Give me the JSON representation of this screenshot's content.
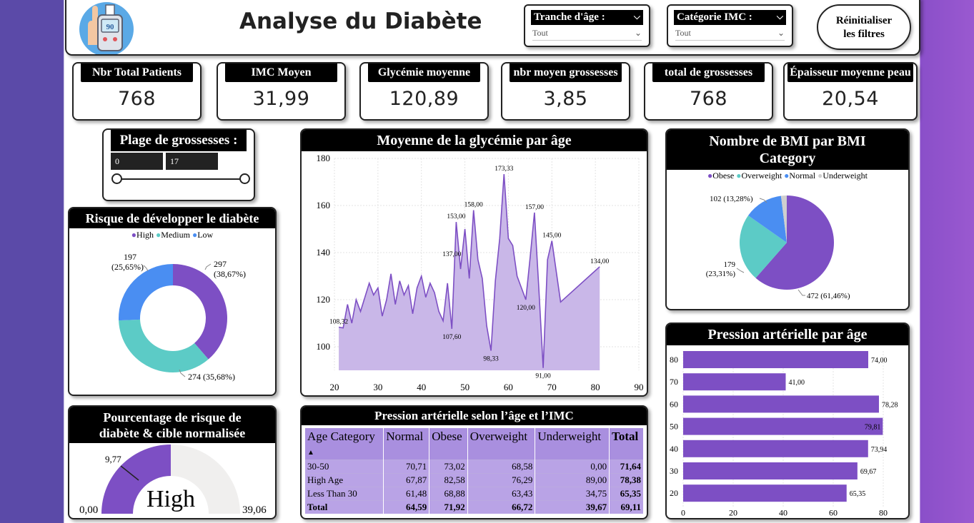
{
  "header": {
    "title": "Analyse du Diabète",
    "logo_number": "90",
    "age_slicer": {
      "label": "Tranche d'âge :",
      "value": "Tout"
    },
    "bmi_slicer": {
      "label": "Catégorie IMC :",
      "value": "Tout"
    },
    "reset_line1": "Réinitialiser",
    "reset_line2": "les filtres"
  },
  "kpis": [
    {
      "label": "Nbr Total Patients",
      "value": "768"
    },
    {
      "label": "IMC Moyen",
      "value": "31,99"
    },
    {
      "label": "Glycémie moyenne",
      "value": "120,89"
    },
    {
      "label": "nbr moyen grossesses",
      "value": "3,85"
    },
    {
      "label": "total de grossesses",
      "value": "768"
    },
    {
      "label": "Épaisseur moyenne peau",
      "value": "20,54"
    }
  ],
  "pregnancy_range": {
    "title": "Plage de grossesses :",
    "min": "0",
    "max": "17"
  },
  "risk": {
    "title": "Risque de développer le diabète",
    "legend": [
      "High",
      "Medium",
      "Low"
    ],
    "labels": [
      {
        "a": "297",
        "b": "(38,67%)"
      },
      {
        "a": "274 (35,68%)",
        "b": ""
      },
      {
        "a": "197",
        "b": "(25,65%)"
      }
    ]
  },
  "gauge": {
    "title_line1": "Pourcentage de risque de",
    "title_line2": "diabète & cible normalisée",
    "min": "0,00",
    "max": "39,06",
    "target": "9,77",
    "label": "High"
  },
  "glucose_chart": {
    "title": "Moyenne de la glycémie par âge"
  },
  "bmi_pie": {
    "title_line1": "Nombre de BMI par BMI",
    "title_line2": "Category"
  },
  "bp_chart": {
    "title": "Pression artérielle par âge"
  },
  "matrix": {
    "title": "Pression artérielle selon l’âge et l’IMC",
    "headers": [
      "Age Category",
      "Normal",
      "Obese",
      "Overweight",
      "Underweight",
      "Total"
    ],
    "rows": [
      [
        "30-50",
        "70,71",
        "73,02",
        "68,58",
        "0,00",
        "71,64"
      ],
      [
        "High Age",
        "67,87",
        "82,58",
        "76,29",
        "89,00",
        "78,38"
      ],
      [
        "Less Than 30",
        "61,48",
        "68,88",
        "63,43",
        "34,75",
        "65,35"
      ],
      [
        "Total",
        "64,59",
        "71,92",
        "66,72",
        "39,67",
        "69,11"
      ]
    ]
  },
  "colors": {
    "purple": "#7d4fc4",
    "teal": "#5ccbc6",
    "blue": "#4a8ef2",
    "grey": "#cfcfcf",
    "area": "#c9b7e8"
  },
  "chart_data": [
    {
      "type": "area",
      "title": "Moyenne de la glycémie par âge",
      "xlim": [
        20,
        90
      ],
      "ylim": [
        90,
        180
      ],
      "xticks": [
        20,
        30,
        40,
        50,
        60,
        70,
        80,
        90
      ],
      "yticks": [
        100,
        120,
        140,
        160,
        180
      ],
      "x": [
        21,
        22,
        23,
        24,
        25,
        26,
        27,
        28,
        29,
        30,
        31,
        32,
        33,
        34,
        35,
        36,
        37,
        38,
        39,
        40,
        41,
        42,
        43,
        44,
        45,
        46,
        47,
        48,
        49,
        50,
        51,
        52,
        53,
        54,
        55,
        56,
        57,
        58,
        59,
        60,
        61,
        62,
        63,
        64,
        65,
        66,
        67,
        68,
        69,
        70,
        72,
        81
      ],
      "y": [
        108.32,
        108,
        118,
        110,
        120,
        115,
        121,
        127,
        122,
        125,
        113,
        120,
        131,
        118,
        128,
        122,
        126,
        114,
        125,
        130,
        121,
        127,
        123,
        115,
        111,
        127,
        107.6,
        153,
        133,
        150,
        129,
        158,
        137,
        129,
        109,
        98.33,
        128,
        146,
        173.33,
        146,
        143,
        130,
        125,
        120,
        138,
        157,
        125,
        91,
        137,
        145,
        119,
        134,
        134
      ],
      "labels": [
        {
          "x": 21,
          "y": 108.32,
          "t": "108,32"
        },
        {
          "x": 47,
          "y": 107.6,
          "t": "107,60"
        },
        {
          "x": 47,
          "y": 137,
          "t": "137,00"
        },
        {
          "x": 48,
          "y": 153,
          "t": "153,00"
        },
        {
          "x": 52,
          "y": 158,
          "t": "158,00"
        },
        {
          "x": 56,
          "y": 98.33,
          "t": "98,33"
        },
        {
          "x": 59,
          "y": 173.33,
          "t": "173,33"
        },
        {
          "x": 64,
          "y": 120,
          "t": "120,00"
        },
        {
          "x": 66,
          "y": 157,
          "t": "157,00"
        },
        {
          "x": 68,
          "y": 91,
          "t": "91,00"
        },
        {
          "x": 70,
          "y": 145,
          "t": "145,00"
        },
        {
          "x": 81,
          "y": 134,
          "t": "134,00"
        }
      ]
    },
    {
      "type": "pie",
      "title": "Nombre de BMI par BMI Category",
      "legend": [
        "Obese",
        "Overweight",
        "Normal",
        "Underweight"
      ],
      "values": [
        472,
        179,
        102,
        15
      ],
      "labels": [
        "472 (61,46%)",
        "179 (23,31%)",
        "102 (13,28%)",
        ""
      ]
    },
    {
      "type": "bar",
      "title": "Pression artérielle par âge",
      "categories": [
        "80",
        "70",
        "60",
        "50",
        "40",
        "30",
        "20"
      ],
      "values": [
        74.0,
        41.0,
        78.28,
        79.81,
        73.94,
        69.67,
        65.35
      ],
      "value_labels": [
        "74,00",
        "41,00",
        "78,28",
        "79,81",
        "73,94",
        "69,67",
        "65,35"
      ],
      "xlim": [
        0,
        80
      ],
      "xticks": [
        0,
        20,
        40,
        60,
        80
      ]
    },
    {
      "type": "pie",
      "title": "Risque de développer le diabète",
      "legend": [
        "High",
        "Medium",
        "Low"
      ],
      "values": [
        297,
        274,
        197
      ],
      "labels": [
        "297 (38,67%)",
        "274 (35,68%)",
        "197 (25,65%)"
      ]
    }
  ]
}
